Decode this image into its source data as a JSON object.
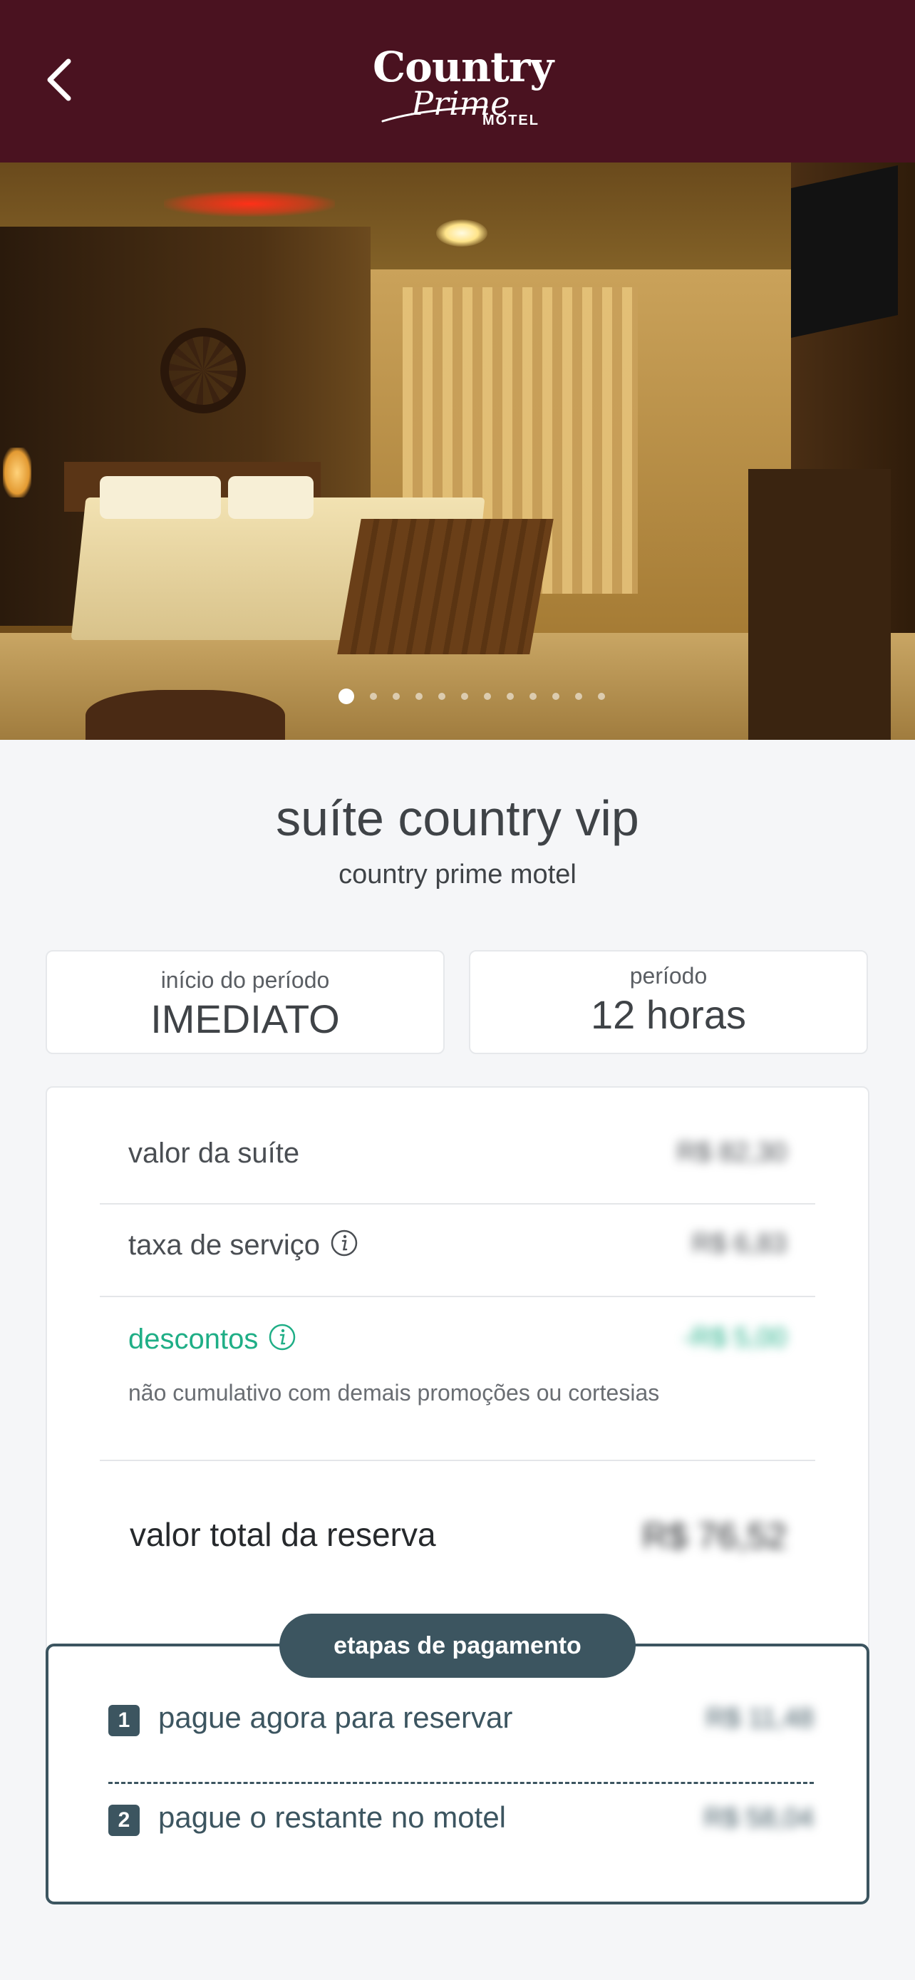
{
  "header": {
    "logo": {
      "brand": "Country",
      "script": "Prime",
      "sub": "MOTEL"
    }
  },
  "gallery": {
    "total_images": 12,
    "active_index": 0
  },
  "suite": {
    "name": "suíte country vip",
    "motel": "country prime motel"
  },
  "period": {
    "start_label": "início do período",
    "start_value": "IMEDIATO",
    "duration_label": "período",
    "duration_value": "12 horas"
  },
  "pricing": {
    "suite_value_label": "valor da suíte",
    "suite_value_amount": "R$ 82,30",
    "service_fee_label": "taxa de serviço",
    "service_fee_amount": "R$ 6,83",
    "discounts_label": "descontos",
    "discounts_amount": "-R$ 5,00",
    "discounts_note": "não cumulativo com demais promoções ou cortesias",
    "total_label": "valor total da reserva",
    "total_amount": "R$ 76,52"
  },
  "payment_steps": {
    "title": "etapas de pagamento",
    "steps": [
      {
        "number": "1",
        "label": "pague agora para reservar",
        "amount": "R$ 11,48"
      },
      {
        "number": "2",
        "label": "pague o restante no motel",
        "amount": "R$ 58,04"
      }
    ]
  },
  "colors": {
    "header_bg": "#4a1220",
    "accent_green": "#1fae86",
    "steps_slate": "#3c5560",
    "page_bg": "#f5f6f8"
  },
  "icons": {
    "back": "chevron-left-icon",
    "info": "info-circle-icon"
  }
}
